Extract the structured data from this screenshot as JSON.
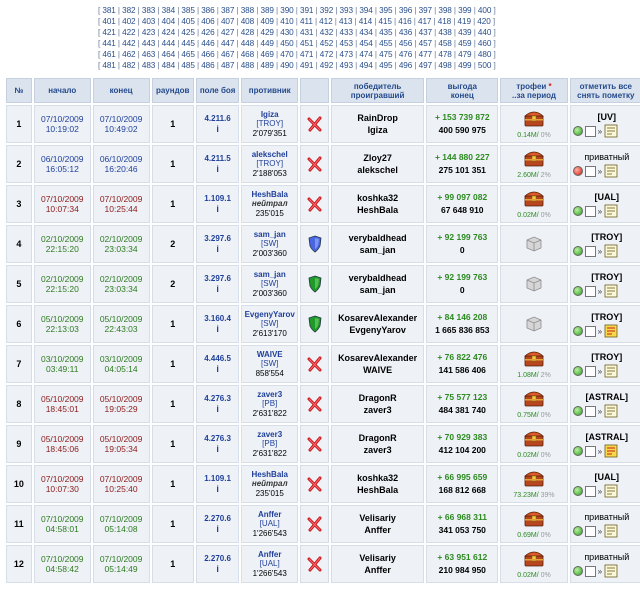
{
  "pager": {
    "rows": [
      [
        "381",
        "382",
        "383",
        "384",
        "385",
        "386",
        "387",
        "388",
        "389",
        "390",
        "391",
        "392",
        "393",
        "394",
        "395",
        "396",
        "397",
        "398",
        "399",
        "400"
      ],
      [
        "401",
        "402",
        "403",
        "404",
        "405",
        "406",
        "407",
        "408",
        "409",
        "410",
        "411",
        "412",
        "413",
        "414",
        "415",
        "416",
        "417",
        "418",
        "419",
        "420"
      ],
      [
        "421",
        "422",
        "423",
        "424",
        "425",
        "426",
        "427",
        "428",
        "429",
        "430",
        "431",
        "432",
        "433",
        "434",
        "435",
        "436",
        "437",
        "438",
        "439",
        "440"
      ],
      [
        "441",
        "442",
        "443",
        "444",
        "445",
        "446",
        "447",
        "448",
        "449",
        "450",
        "451",
        "452",
        "453",
        "454",
        "455",
        "456",
        "457",
        "458",
        "459",
        "460"
      ],
      [
        "461",
        "462",
        "463",
        "464",
        "465",
        "466",
        "467",
        "468",
        "469",
        "470",
        "471",
        "472",
        "473",
        "474",
        "475",
        "476",
        "477",
        "478",
        "479",
        "480"
      ],
      [
        "481",
        "482",
        "483",
        "484",
        "485",
        "486",
        "487",
        "488",
        "489",
        "490",
        "491",
        "492",
        "493",
        "494",
        "495",
        "496",
        "497",
        "498",
        "499",
        "500"
      ]
    ]
  },
  "headers": {
    "num": "№",
    "start": "начало",
    "end": "конец",
    "rounds": "раундов",
    "field": "поле боя",
    "opponent": "противник",
    "result": "",
    "winner_line1": "победитель",
    "winner_line2": "проигравший",
    "gain_line1": "выгода",
    "gain_line2": "конец",
    "trophy_line1": "трофеи",
    "trophy_star": "*",
    "trophy_line2": "..за период",
    "mark_line1": "отметить все",
    "mark_line2": "снять пометку"
  },
  "colors": {
    "header_bg": "#dbe3ee",
    "row_bg": "#eef2f7",
    "link_blue": "#1f3f9a",
    "gain_green": "#2c8a1f",
    "date_green": "#2c7a1f",
    "date_red": "#8b1a1a",
    "date_blue": "#1f3f9a"
  },
  "rows": [
    {
      "num": "1",
      "start_date": "07/10/2009",
      "start_time": "10:19:02",
      "end_date": "07/10/2009",
      "end_time": "10:49:02",
      "date_color": "blue",
      "rounds": "1",
      "field": "4.211.6",
      "info": "i",
      "opp_name": "Igiza",
      "opp_clan": "[TROY]",
      "opp_italic": false,
      "opp_stat": "2'079'351",
      "result": "lose",
      "winner": "RainDrop",
      "loser": "Igiza",
      "gain": "+ 153 739 872",
      "gain_end": "400 590 975",
      "trophy": "chest",
      "trophy_txt": "0.14M/",
      "trophy_pct": "0%",
      "mark_label": "[UV]",
      "mark_bold": true,
      "dot": "green",
      "note_yellow": false
    },
    {
      "num": "2",
      "start_date": "06/10/2009",
      "start_time": "16:05:12",
      "end_date": "06/10/2009",
      "end_time": "16:20:46",
      "date_color": "blue",
      "rounds": "1",
      "field": "4.211.5",
      "info": "i",
      "opp_name": "alekschel",
      "opp_clan": "[TROY]",
      "opp_italic": false,
      "opp_stat": "2'188'053",
      "result": "lose",
      "winner": "Zloy27",
      "loser": "alekschel",
      "gain": "+ 144 880 227",
      "gain_end": "275 101 351",
      "trophy": "chest",
      "trophy_txt": "2.60M/",
      "trophy_pct": "2%",
      "mark_label": "приватный",
      "mark_bold": false,
      "dot": "red",
      "note_yellow": false
    },
    {
      "num": "3",
      "start_date": "07/10/2009",
      "start_time": "10:07:34",
      "end_date": "07/10/2009",
      "end_time": "10:25:44",
      "date_color": "red",
      "rounds": "1",
      "field": "1.109.1",
      "info": "i",
      "opp_name": "HeshBala",
      "opp_clan": "нейтрал",
      "opp_italic": true,
      "opp_stat": "235'015",
      "result": "lose",
      "winner": "koshka32",
      "loser": "HeshBala",
      "gain": "+ 99 097 082",
      "gain_end": "67 648 910",
      "trophy": "chest",
      "trophy_txt": "0.02M/",
      "trophy_pct": "0%",
      "mark_label": "[UAL]",
      "mark_bold": true,
      "dot": "green",
      "note_yellow": false
    },
    {
      "num": "4",
      "start_date": "02/10/2009",
      "start_time": "22:15:20",
      "end_date": "02/10/2009",
      "end_time": "23:03:34",
      "date_color": "green",
      "rounds": "2",
      "field": "3.297.6",
      "info": "i",
      "opp_name": "sam_jan",
      "opp_clan": "[SW]",
      "opp_italic": false,
      "opp_stat": "2'003'360",
      "result": "shield-blue",
      "winner": "verybaldhead",
      "loser": "sam_jan",
      "gain": "+ 92 199 763",
      "gain_end": "0",
      "trophy": "box",
      "trophy_txt": "",
      "trophy_pct": "",
      "mark_label": "[TROY]",
      "mark_bold": true,
      "dot": "green",
      "note_yellow": false
    },
    {
      "num": "5",
      "start_date": "02/10/2009",
      "start_time": "22:15:20",
      "end_date": "02/10/2009",
      "end_time": "23:03:34",
      "date_color": "green",
      "rounds": "2",
      "field": "3.297.6",
      "info": "i",
      "opp_name": "sam_jan",
      "opp_clan": "[SW]",
      "opp_italic": false,
      "opp_stat": "2'003'360",
      "result": "shield-green",
      "winner": "verybaldhead",
      "loser": "sam_jan",
      "gain": "+ 92 199 763",
      "gain_end": "0",
      "trophy": "box",
      "trophy_txt": "",
      "trophy_pct": "",
      "mark_label": "[TROY]",
      "mark_bold": true,
      "dot": "green",
      "note_yellow": false
    },
    {
      "num": "6",
      "start_date": "05/10/2009",
      "start_time": "22:13:03",
      "end_date": "05/10/2009",
      "end_time": "22:43:03",
      "date_color": "green",
      "rounds": "1",
      "field": "3.160.4",
      "info": "i",
      "opp_name": "EvgenyYarov",
      "opp_clan": "[SW]",
      "opp_italic": false,
      "opp_stat": "2'613'170",
      "result": "shield-green",
      "winner": "KosarevAlexander",
      "loser": "EvgenyYarov",
      "gain": "+ 84 146 208",
      "gain_end": "1 665 836 853",
      "trophy": "box",
      "trophy_txt": "",
      "trophy_pct": "",
      "mark_label": "[TROY]",
      "mark_bold": true,
      "dot": "green",
      "note_yellow": true
    },
    {
      "num": "7",
      "start_date": "03/10/2009",
      "start_time": "03:49:11",
      "end_date": "03/10/2009",
      "end_time": "04:05:14",
      "date_color": "green",
      "rounds": "1",
      "field": "4.446.5",
      "info": "i",
      "opp_name": "WAIVE",
      "opp_clan": "[SW]",
      "opp_italic": false,
      "opp_stat": "858'554",
      "result": "lose",
      "winner": "KosarevAlexander",
      "loser": "WAIVE",
      "gain": "+ 76 822 476",
      "gain_end": "141 586 406",
      "trophy": "chest",
      "trophy_txt": "1.08M/",
      "trophy_pct": "2%",
      "mark_label": "[TROY]",
      "mark_bold": true,
      "dot": "green",
      "note_yellow": false
    },
    {
      "num": "8",
      "start_date": "05/10/2009",
      "start_time": "18:45:01",
      "end_date": "05/10/2009",
      "end_time": "19:05:29",
      "date_color": "red",
      "rounds": "1",
      "field": "4.276.3",
      "info": "i",
      "opp_name": "zaver3",
      "opp_clan": "[PB]",
      "opp_italic": false,
      "opp_stat": "2'631'822",
      "result": "lose",
      "winner": "DragonR",
      "loser": "zaver3",
      "gain": "+ 75 577 123",
      "gain_end": "484 381 740",
      "trophy": "chest",
      "trophy_txt": "0.75M/",
      "trophy_pct": "0%",
      "mark_label": "[ASTRAL]",
      "mark_bold": true,
      "dot": "green",
      "note_yellow": false
    },
    {
      "num": "9",
      "start_date": "05/10/2009",
      "start_time": "18:45:06",
      "end_date": "05/10/2009",
      "end_time": "19:05:34",
      "date_color": "red",
      "rounds": "1",
      "field": "4.276.3",
      "info": "i",
      "opp_name": "zaver3",
      "opp_clan": "[PB]",
      "opp_italic": false,
      "opp_stat": "2'631'822",
      "result": "lose",
      "winner": "DragonR",
      "loser": "zaver3",
      "gain": "+ 70 929 383",
      "gain_end": "412 104 200",
      "trophy": "chest",
      "trophy_txt": "0.02M/",
      "trophy_pct": "0%",
      "mark_label": "[ASTRAL]",
      "mark_bold": true,
      "dot": "green",
      "note_yellow": true
    },
    {
      "num": "10",
      "start_date": "07/10/2009",
      "start_time": "10:07:30",
      "end_date": "07/10/2009",
      "end_time": "10:25:40",
      "date_color": "red",
      "rounds": "1",
      "field": "1.109.1",
      "info": "i",
      "opp_name": "HeshBala",
      "opp_clan": "нейтрал",
      "opp_italic": true,
      "opp_stat": "235'015",
      "result": "lose",
      "winner": "koshka32",
      "loser": "HeshBala",
      "gain": "+ 66 995 659",
      "gain_end": "168 812 668",
      "trophy": "chest",
      "trophy_txt": "73.23M/",
      "trophy_pct": "39%",
      "mark_label": "[UAL]",
      "mark_bold": true,
      "dot": "green",
      "note_yellow": false
    },
    {
      "num": "11",
      "start_date": "07/10/2009",
      "start_time": "04:58:01",
      "end_date": "07/10/2009",
      "end_time": "05:14:08",
      "date_color": "green",
      "rounds": "1",
      "field": "2.270.6",
      "info": "i",
      "opp_name": "Anffer",
      "opp_clan": "[UAL]",
      "opp_italic": false,
      "opp_stat": "1'266'543",
      "result": "lose",
      "winner": "Velisariy",
      "loser": "Anffer",
      "gain": "+ 66 968 311",
      "gain_end": "341 053 750",
      "trophy": "chest",
      "trophy_txt": "0.69M/",
      "trophy_pct": "0%",
      "mark_label": "приватный",
      "mark_bold": false,
      "dot": "green",
      "note_yellow": false
    },
    {
      "num": "12",
      "start_date": "07/10/2009",
      "start_time": "04:58:42",
      "end_date": "07/10/2009",
      "end_time": "05:14:49",
      "date_color": "green",
      "rounds": "1",
      "field": "2.270.6",
      "info": "i",
      "opp_name": "Anffer",
      "opp_clan": "[UAL]",
      "opp_italic": false,
      "opp_stat": "1'266'543",
      "result": "lose",
      "winner": "Velisariy",
      "loser": "Anffer",
      "gain": "+ 63 951 612",
      "gain_end": "210 984 950",
      "trophy": "chest",
      "trophy_txt": "0.02M/",
      "trophy_pct": "0%",
      "mark_label": "приватный",
      "mark_bold": false,
      "dot": "green",
      "note_yellow": false
    }
  ]
}
